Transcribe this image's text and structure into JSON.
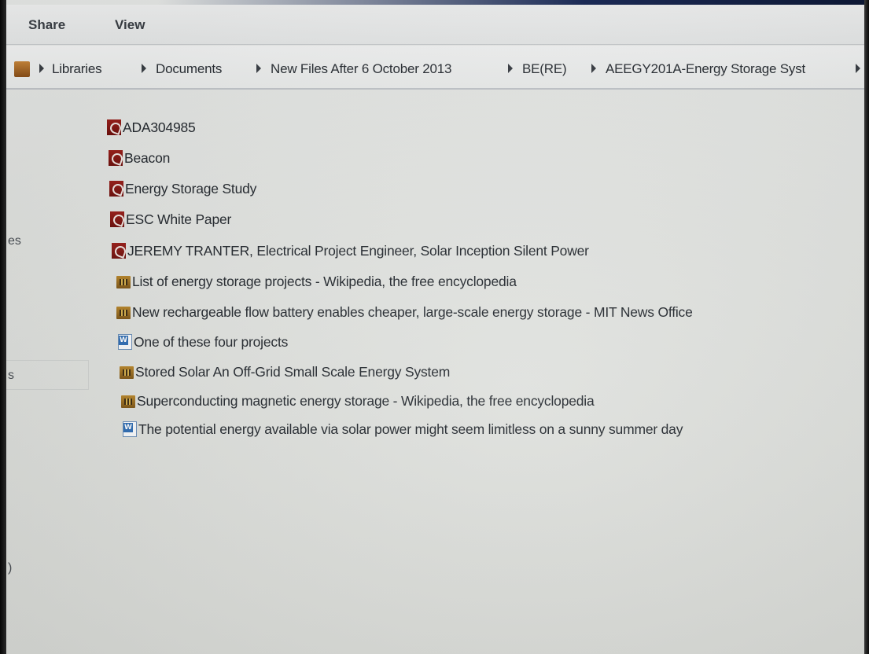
{
  "ribbon": {
    "tabs": [
      "Share",
      "View"
    ]
  },
  "address": {
    "crumbs": [
      "Libraries",
      "Documents",
      "New Files After 6 October 2013",
      "BE(RE)",
      "AEEGY201A-Energy Storage Syst"
    ],
    "folder_icon": "folder-icon"
  },
  "nav_fragments": [
    "es",
    "s",
    ")"
  ],
  "files": [
    {
      "name": "ADA304985",
      "icon": "pdf-icon"
    },
    {
      "name": "Beacon",
      "icon": "pdf-icon"
    },
    {
      "name": "Energy Storage Study",
      "icon": "pdf-icon"
    },
    {
      "name": "ESC White Paper",
      "icon": "pdf-icon"
    },
    {
      "name": "JEREMY TRANTER, Electrical Project Engineer, Solar Inception Silent Power",
      "icon": "pdf-icon"
    },
    {
      "name": "List of energy storage projects - Wikipedia, the free encyclopedia",
      "icon": "html-icon"
    },
    {
      "name": "New rechargeable flow battery enables cheaper, large-scale energy storage - MIT News Office",
      "icon": "html-icon"
    },
    {
      "name": "One of these four projects",
      "icon": "word-doc-icon"
    },
    {
      "name": "Stored Solar  An Off-Grid Small Scale Energy System",
      "icon": "html-icon"
    },
    {
      "name": "Superconducting magnetic energy storage - Wikipedia, the free encyclopedia",
      "icon": "html-icon"
    },
    {
      "name": "The potential energy available via solar power might seem limitless on a sunny summer day",
      "icon": "word-doc-icon"
    }
  ]
}
